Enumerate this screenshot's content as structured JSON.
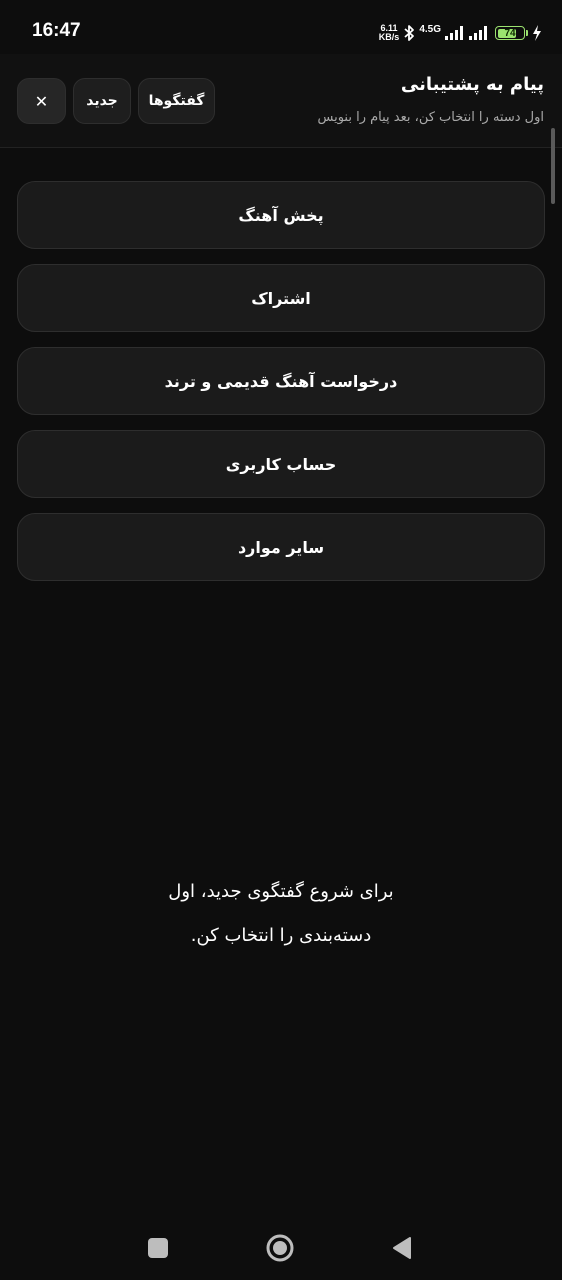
{
  "status_bar": {
    "time": "16:47",
    "net_speed_value": "6.11",
    "net_speed_unit": "KB/s",
    "network_type": "4.5G",
    "battery_level": "74",
    "battery_color": "#9be36f"
  },
  "header": {
    "title": "پیام به پشتیبانی",
    "subtitle": "اول دسته را انتخاب کن، بعد پیام را بنویس",
    "conversations_label": "گفتگوها",
    "new_label": "جدید",
    "close_label": "✕"
  },
  "categories": [
    {
      "label": "پخش آهنگ"
    },
    {
      "label": "اشتراک"
    },
    {
      "label": "درخواست آهنگ قدیمی و ترند"
    },
    {
      "label": "حساب کاربری"
    },
    {
      "label": "سایر موارد"
    }
  ],
  "empty_hint": {
    "line1": "برای شروع گفتگوی جدید، اول",
    "line2": "دسته‌بندی را انتخاب کن."
  },
  "nav": {
    "recents_icon": "square-icon",
    "home_icon": "circle-icon",
    "back_icon": "triangle-icon"
  },
  "colors": {
    "background": "#0d0d0d",
    "card": "#1b1b1b",
    "border": "#2e2e2e"
  }
}
